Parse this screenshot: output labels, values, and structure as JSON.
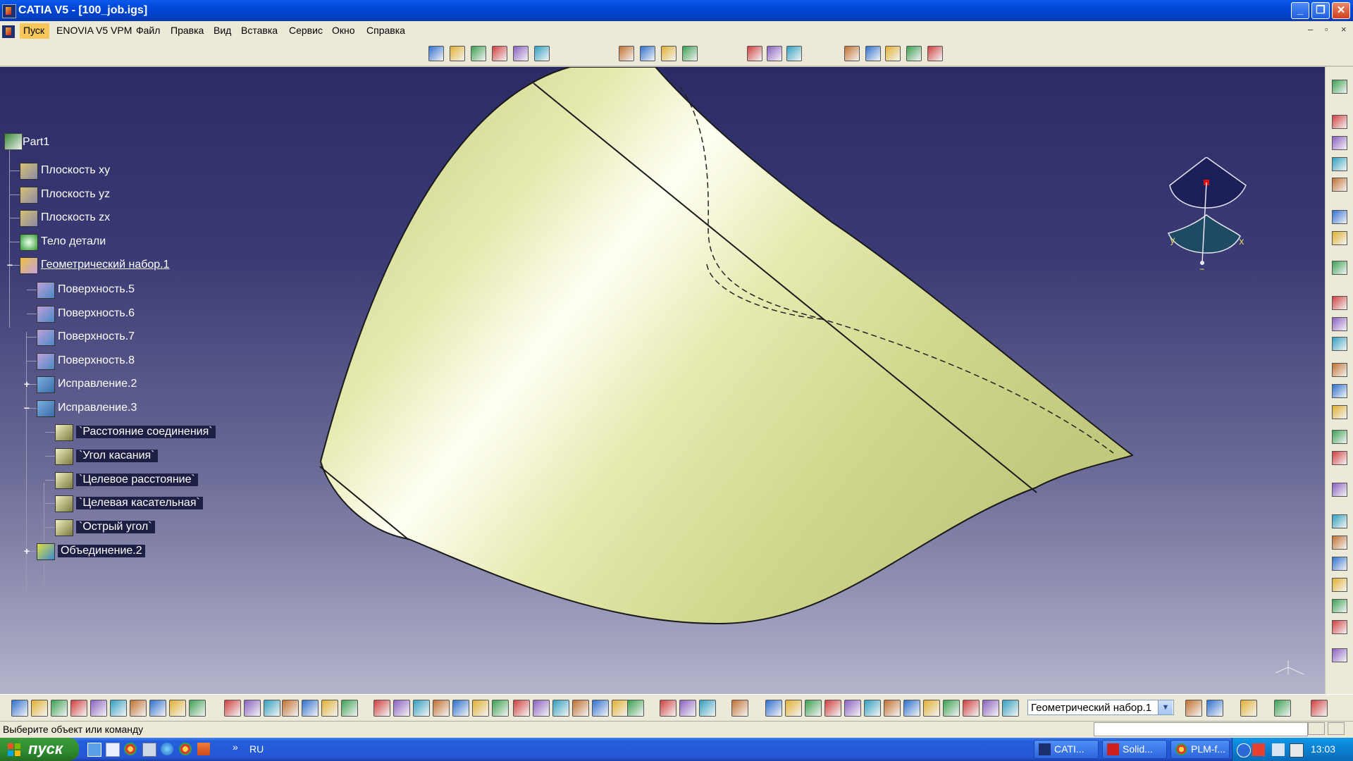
{
  "window": {
    "title": "CATIA V5 - [100_job.igs]",
    "minimize": "_",
    "maximize": "❐",
    "close": "✕"
  },
  "menu": {
    "items": [
      "Пуск",
      "ENOVIA V5 VPM",
      "Файл",
      "Правка",
      "Вид",
      "Вставка",
      "Сервис",
      "Окно",
      "Справка"
    ],
    "mdi_controls": [
      "–",
      "▫",
      "×"
    ]
  },
  "tree": {
    "root": "Part1",
    "nodes": [
      {
        "label": "Плоскость xy",
        "icon": "plane-icon"
      },
      {
        "label": "Плоскость yz",
        "icon": "plane-icon"
      },
      {
        "label": "Плоскость zx",
        "icon": "plane-icon"
      },
      {
        "label": "Тело детали",
        "icon": "gear-icon"
      },
      {
        "label": "Геометрический набор.1",
        "icon": "geometric-set-icon"
      },
      {
        "label": "Поверхность.5",
        "icon": "surface-icon"
      },
      {
        "label": "Поверхность.6",
        "icon": "surface-icon"
      },
      {
        "label": "Поверхность.7",
        "icon": "surface-icon"
      },
      {
        "label": "Поверхность.8",
        "icon": "surface-icon"
      },
      {
        "label": "Исправление.2",
        "icon": "fix-icon"
      },
      {
        "label": "Исправление.3",
        "icon": "fix-icon"
      },
      {
        "label": "`Расстояние соединения`",
        "icon": "parameter-icon"
      },
      {
        "label": "`Угол касания`",
        "icon": "parameter-icon"
      },
      {
        "label": "`Целевое расстояние`",
        "icon": "parameter-icon"
      },
      {
        "label": "`Целевая касательная`",
        "icon": "parameter-icon"
      },
      {
        "label": "`Острый угол`",
        "icon": "parameter-icon"
      },
      {
        "label": "Объединение.2",
        "icon": "join-icon"
      }
    ]
  },
  "compass": {
    "x_label": "x",
    "y_label": "y",
    "z_label": "z"
  },
  "toolbar": {
    "current_set": "Геометрический набор.1"
  },
  "status": {
    "prompt": "Выберите объект или команду"
  },
  "taskbar": {
    "start_label": "пуск",
    "language": "RU",
    "tasks": [
      "CATI...",
      "Solid...",
      "PLM-f..."
    ],
    "clock": "13:03"
  },
  "colors": {
    "surface": "#D6DC98",
    "surface_highlight": "#FFFFF0",
    "viewport_top": "#2b2b66",
    "viewport_bottom": "#b4b4cc",
    "title_bar": "#0046D6"
  }
}
